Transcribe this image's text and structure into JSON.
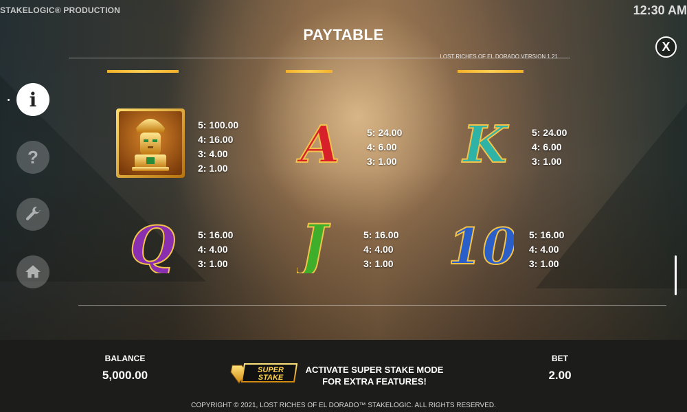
{
  "header": {
    "brand": "STAKELOGIC® PRODUCTION",
    "time": "12:30 AM",
    "title": "PAYTABLE",
    "version": "LOST RICHES OF EL DORADO VERSION 1.21",
    "close_label": "X"
  },
  "sidebar": {
    "info_label": "i",
    "help_label": "?"
  },
  "symbols": [
    {
      "name": "golden-idol",
      "pays": [
        "5: 100.00",
        "4: 16.00",
        "3: 4.00",
        "2: 1.00"
      ]
    },
    {
      "name": "letter-a",
      "glyph": "A",
      "pays": [
        "5: 24.00",
        "4: 6.00",
        "3: 1.00"
      ]
    },
    {
      "name": "letter-k",
      "glyph": "K",
      "pays": [
        "5: 24.00",
        "4: 6.00",
        "3: 1.00"
      ]
    },
    {
      "name": "letter-q",
      "glyph": "Q",
      "pays": [
        "5: 16.00",
        "4: 4.00",
        "3: 1.00"
      ]
    },
    {
      "name": "letter-j",
      "glyph": "J",
      "pays": [
        "5: 16.00",
        "4: 4.00",
        "3: 1.00"
      ]
    },
    {
      "name": "number-10",
      "glyph": "10",
      "pays": [
        "5: 16.00",
        "4: 4.00",
        "3: 1.00"
      ]
    }
  ],
  "footer": {
    "balance_label": "BALANCE",
    "balance_value": "5,000.00",
    "promo_line1": "ACTIVATE SUPER STAKE MODE",
    "promo_line2": "FOR EXTRA FEATURES!",
    "logo_text_1": "SUPER",
    "logo_text_2": "STAKE",
    "bet_label": "BET",
    "bet_value": "2.00",
    "copyright": "COPYRIGHT © 2021, LOST RICHES OF EL DORADO™ STAKELOGIC. ALL RIGHTS RESERVED."
  },
  "colors": {
    "accent_gold": "#f4b12a",
    "symbol_a": "#d8202a",
    "symbol_k": "#2fb3a6",
    "symbol_q": "#8a2fb0",
    "symbol_j": "#3fae2a",
    "symbol_10": "#2a5fc9"
  }
}
